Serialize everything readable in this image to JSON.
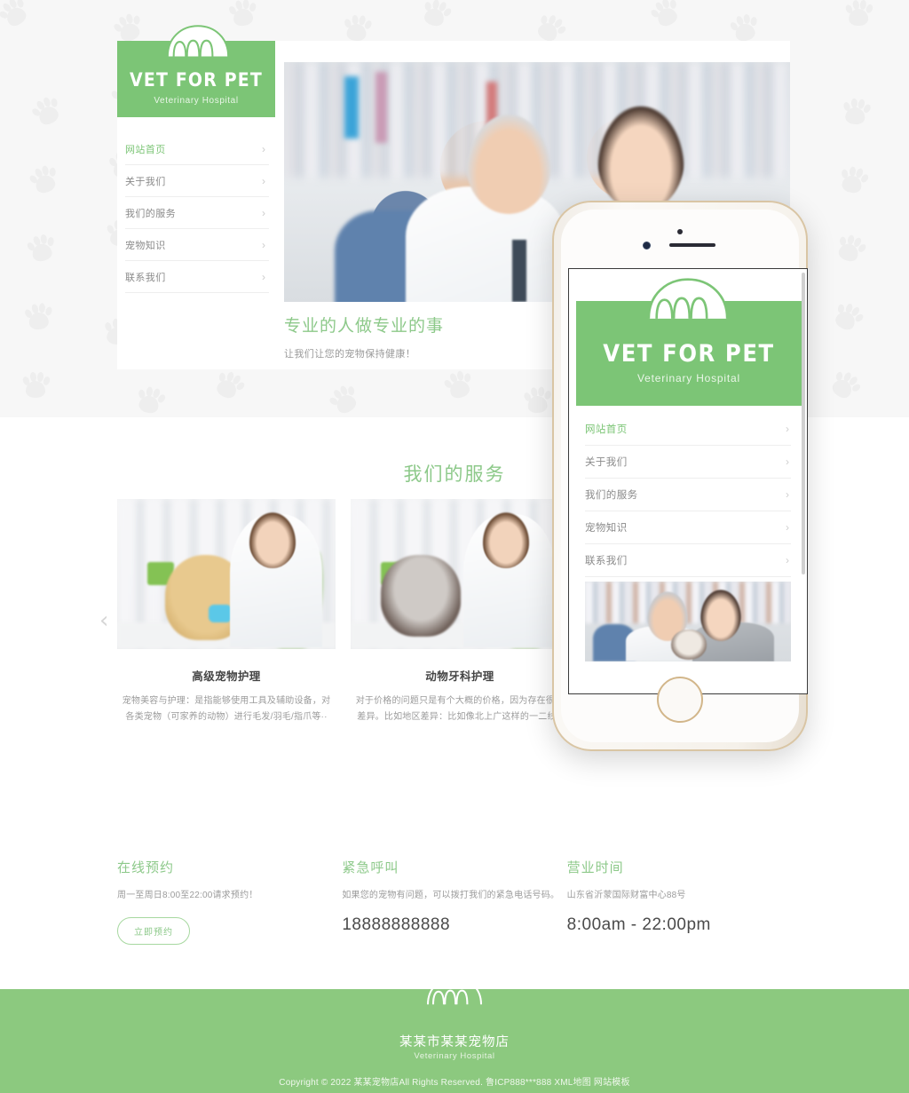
{
  "brand": {
    "logo_icon": "paw-icon",
    "title": "VET FOR PET",
    "subtitle": "Veterinary Hospital"
  },
  "sidebar": {
    "items": [
      {
        "label": "网站首页",
        "active": true,
        "chevron": "›"
      },
      {
        "label": "关于我们",
        "active": false,
        "chevron": "›"
      },
      {
        "label": "我们的服务",
        "active": false,
        "chevron": "›"
      },
      {
        "label": "宠物知识",
        "active": false,
        "chevron": "›"
      },
      {
        "label": "联系我们",
        "active": false,
        "chevron": "›"
      }
    ]
  },
  "hero": {
    "title": "专业的人做专业的事",
    "subtitle": "让我们让您的宠物保持健康！"
  },
  "services": {
    "heading": "我们的服务",
    "prev_arrow": "‹",
    "next_arrow": "›",
    "cards": [
      {
        "name": "高级宠物护理",
        "desc": "宠物美容与护理：是指能够使用工具及辅助设备，对各类宠物（可家养的动物）进行毛发/羽毛/指爪等··"
      },
      {
        "name": "动物牙科护理",
        "desc": "对于价格的问题只是有个大概的价格，因为存在很多差异。比如地区差异：比如像北上广这样的一二线··"
      }
    ]
  },
  "info": {
    "columns": [
      {
        "heading": "在线预约",
        "text": "周一至周日8:00至22:00请求预约！",
        "button": "立即预约"
      },
      {
        "heading": "紧急呼叫",
        "text": "如果您的宠物有问题，可以拨打我们的紧急电话号码。",
        "big": "18888888888"
      },
      {
        "heading": "营业时间",
        "text": "山东省沂蒙国际财富中心88号",
        "big": "8:00am - 22:00pm"
      }
    ]
  },
  "footer": {
    "logo_icon": "paw-icon",
    "name": "某某市某某宠物店",
    "subtitle": "Veterinary Hospital",
    "copyright_prefix": "Copyright © 2022 ",
    "copyright_company": "某某宠物店",
    "copyright_rights": "All Rights Reserved. ",
    "icp": "鲁ICP888***888 ",
    "sitemap": "XML地图 ",
    "template": "网站模板"
  },
  "phone": {
    "brand": {
      "logo_icon": "paw-icon",
      "title": "VET FOR PET",
      "subtitle": "Veterinary Hospital"
    },
    "nav_items": [
      {
        "label": "网站首页",
        "active": true,
        "chevron": "›"
      },
      {
        "label": "关于我们",
        "active": false,
        "chevron": "›"
      },
      {
        "label": "我们的服务",
        "active": false,
        "chevron": "›"
      },
      {
        "label": "宠物知识",
        "active": false,
        "chevron": "›"
      },
      {
        "label": "联系我们",
        "active": false,
        "chevron": "›"
      }
    ]
  },
  "colors": {
    "brand_green": "#7cc576",
    "footer_green": "#8cc97f",
    "heading_green": "#8dc98a",
    "text_gray": "#9b9b9b",
    "page_bg": "#f7f7f7",
    "phone_gold": "#d9c5a4"
  }
}
